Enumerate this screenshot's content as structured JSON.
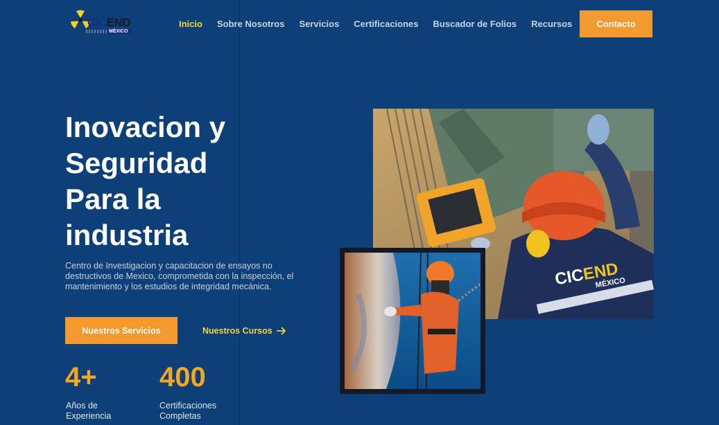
{
  "brand": {
    "word_cic": "CIC",
    "word_end": "END",
    "tag": "MÉXICO"
  },
  "nav": [
    {
      "label": "Inicio",
      "active": true
    },
    {
      "label": "Sobre Nosotros",
      "active": false
    },
    {
      "label": "Servicios",
      "active": false
    },
    {
      "label": "Certificaciones",
      "active": false
    },
    {
      "label": "Buscador de Folios",
      "active": false
    },
    {
      "label": "Recursos",
      "active": false
    }
  ],
  "header": {
    "contact_label": "Contacto"
  },
  "hero": {
    "title_lines": [
      "Inovacion y",
      "Seguridad",
      "Para la",
      "industria"
    ],
    "description": "Centro de Investigacion y capacitacion de ensayos no destructivos de Mexico, comprometida con la inspección, el mantenimiento y los estudios de integridad mecánica.",
    "primary_cta": "Nuestros Servicios",
    "secondary_cta": "Nuestros Cursos"
  },
  "stats": [
    {
      "value": "4+",
      "label_lines": [
        "Años de",
        "Experiencia"
      ]
    },
    {
      "value": "400",
      "label_lines": [
        "Certificaciones",
        "Completas"
      ]
    }
  ],
  "photo_badge": {
    "line1": "CIC",
    "line1b": "END",
    "line2": "MÉXICO"
  },
  "colors": {
    "background": "#0d3f78",
    "accent": "#f29a2e",
    "highlight": "#f4d63a",
    "stat": "#f5a623"
  }
}
